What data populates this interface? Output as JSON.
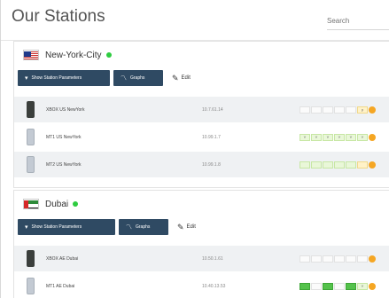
{
  "page": {
    "title": "Our Stations",
    "search_placeholder": "Search"
  },
  "colors": {
    "accent": "#2f4a63",
    "online": "#2ecc40",
    "status": "#f5a623"
  },
  "sections": [
    {
      "city": "New-York-City",
      "flag_icon": "us-flag-icon",
      "status": "online",
      "buttons": {
        "params": "Show Station Parameters",
        "graphs": "Graphs",
        "edit": "Edit"
      },
      "stations": [
        {
          "name": "XBOX US NewYork",
          "ip": "10.7.61.14",
          "device": "dark",
          "bars": [
            "",
            "",
            "",
            "",
            "",
            "y"
          ]
        },
        {
          "name": "MT1 US NewYork",
          "ip": "10.99.1.7",
          "device": "light",
          "bars": [
            "Y",
            "Y",
            "Y",
            "Y",
            "Y",
            "Y"
          ]
        },
        {
          "name": "MT2 US NewYork",
          "ip": "10.99.1.8",
          "device": "light",
          "bars": [
            "",
            "",
            "",
            "",
            "",
            ""
          ]
        }
      ]
    },
    {
      "city": "Dubai",
      "flag_icon": "ae-flag-icon",
      "status": "online",
      "buttons": {
        "params": "Show Station Parameters",
        "graphs": "Graphs",
        "edit": "Edit"
      },
      "stations": [
        {
          "name": "XBOX AE Dubai",
          "ip": "10.50.1.61",
          "device": "dark",
          "bars": [
            "",
            "",
            "",
            "",
            "",
            ""
          ]
        },
        {
          "name": "MT1 AE Dubai",
          "ip": "10.40.13.53",
          "device": "light",
          "bars": [
            "",
            "",
            "",
            "",
            "",
            "Y"
          ]
        }
      ]
    }
  ]
}
